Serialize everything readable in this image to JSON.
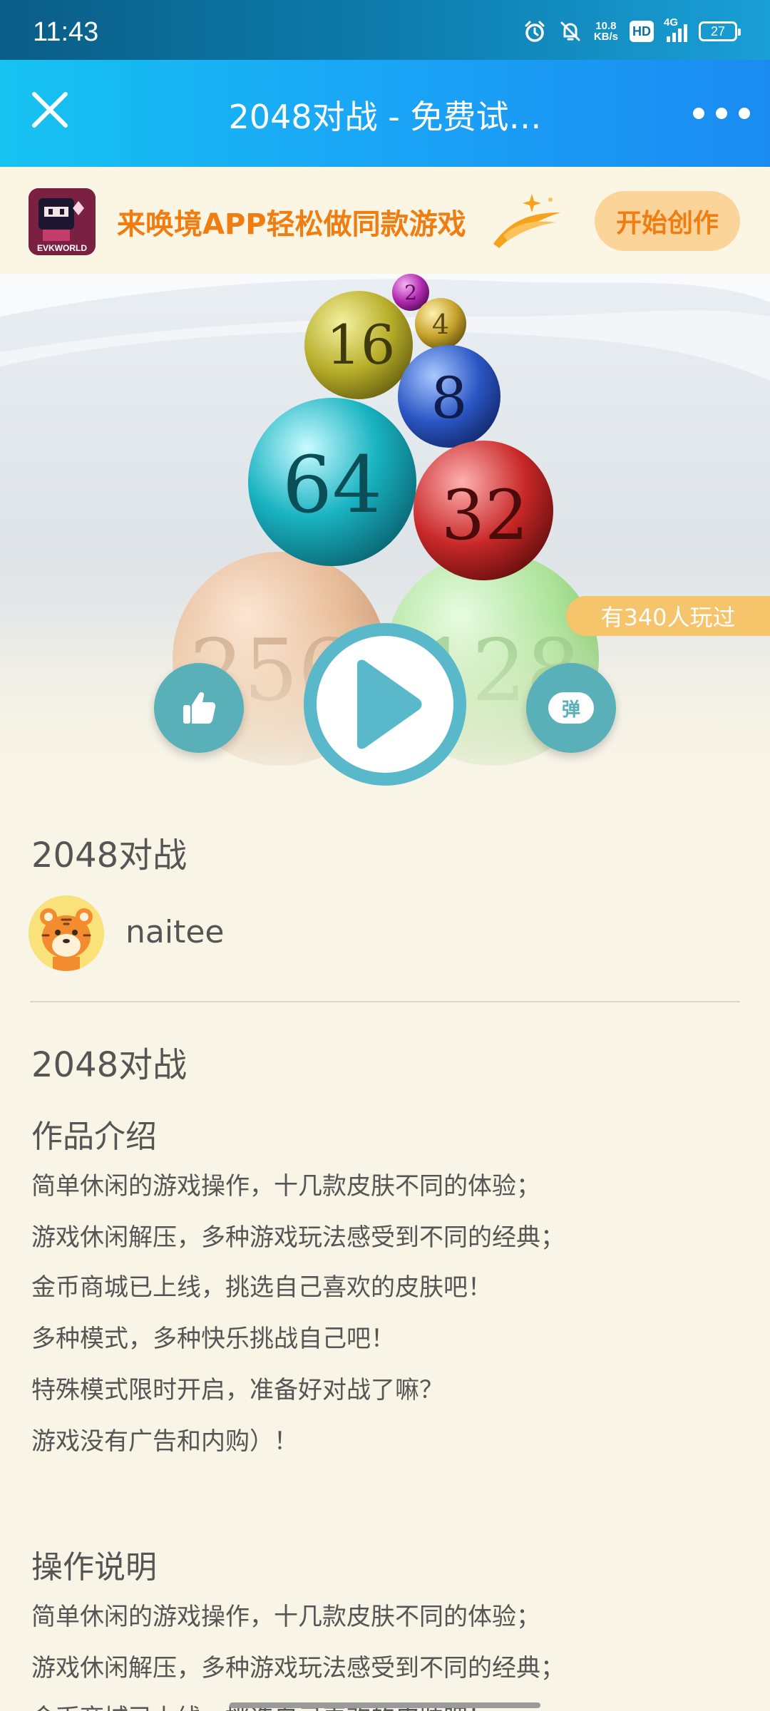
{
  "status_bar": {
    "time": "11:43",
    "net_speed_value": "10.8",
    "net_speed_unit": "KB/s",
    "hd": "HD",
    "network": "4G",
    "battery": "27"
  },
  "header": {
    "title": "2048对战 - 免费试…"
  },
  "promo": {
    "logo_text": "EVKWORLD",
    "text": "来唤境APP轻松做同款游戏",
    "button": "开始创作"
  },
  "hero": {
    "players": "有340人玩过",
    "danmu_label": "弹",
    "ball_labels": [
      "2",
      "4",
      "16",
      "8",
      "64",
      "32",
      "256",
      "128"
    ]
  },
  "game": {
    "title": "2048对战",
    "author": "naitee",
    "work_title": "2048对战",
    "intro_heading": "作品介绍",
    "intro_lines": [
      "简单休闲的游戏操作，十几款皮肤不同的体验；",
      "游戏休闲解压，多种游戏玩法感受到不同的经典；",
      "金币商城已上线，挑选自己喜欢的皮肤吧！",
      "多种模式，多种快乐挑战自己吧！",
      "特殊模式限时开启，准备好对战了嘛？",
      "游戏没有广告和内购）！"
    ],
    "ops_heading": "操作说明",
    "ops_lines": [
      "简单休闲的游戏操作，十几款皮肤不同的体验；",
      "游戏休闲解压，多种游戏玩法感受到不同的经典；",
      "金币商城已上线，挑选自己喜欢的皮肤吧！"
    ]
  },
  "colors": {
    "accent": "#1aa7f6",
    "promo_orange": "#f07d12",
    "round_button": "#5ab0b8",
    "background": "#f8f4e6"
  },
  "icons": {
    "close": "close-icon",
    "more": "more-icon",
    "like": "thumbs-up-icon",
    "play": "play-icon"
  }
}
